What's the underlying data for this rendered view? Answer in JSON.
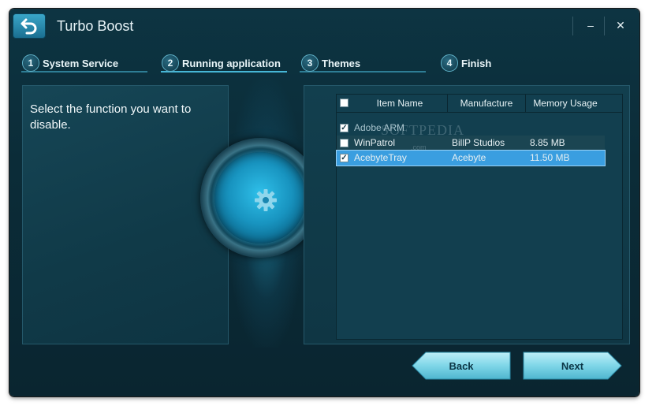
{
  "window": {
    "title": "Turbo Boost",
    "controls": {
      "minimize": "–",
      "close": "✕"
    }
  },
  "steps": [
    {
      "num": "1",
      "label": "System Service"
    },
    {
      "num": "2",
      "label": "Running application"
    },
    {
      "num": "3",
      "label": "Themes"
    },
    {
      "num": "4",
      "label": "Finish"
    }
  ],
  "left": {
    "prompt": "Select the function you want to disable."
  },
  "list": {
    "columns": [
      "Item Name",
      "Manufacture",
      "Memory Usage"
    ],
    "rows": [
      {
        "name": "Adobe ARM",
        "manufacture": "",
        "memory": "",
        "checked": true
      },
      {
        "name": "WinPatrol",
        "manufacture": "BillP Studios",
        "memory": "8.85 MB",
        "checked": false
      },
      {
        "name": "AcebyteTray",
        "manufacture": "Acebyte",
        "memory": "11.50 MB",
        "checked": true
      }
    ]
  },
  "buttons": {
    "back": "Back",
    "next": "Next"
  },
  "watermark": {
    "main": "SOFTPEDIA",
    "sub": ".com"
  },
  "icons": {
    "back": "back-arrow-icon",
    "center": "gear-icon"
  },
  "colors": {
    "accent": "#2fc0ea",
    "selection": "#3a9ee0",
    "button": "#7fd6e8"
  }
}
